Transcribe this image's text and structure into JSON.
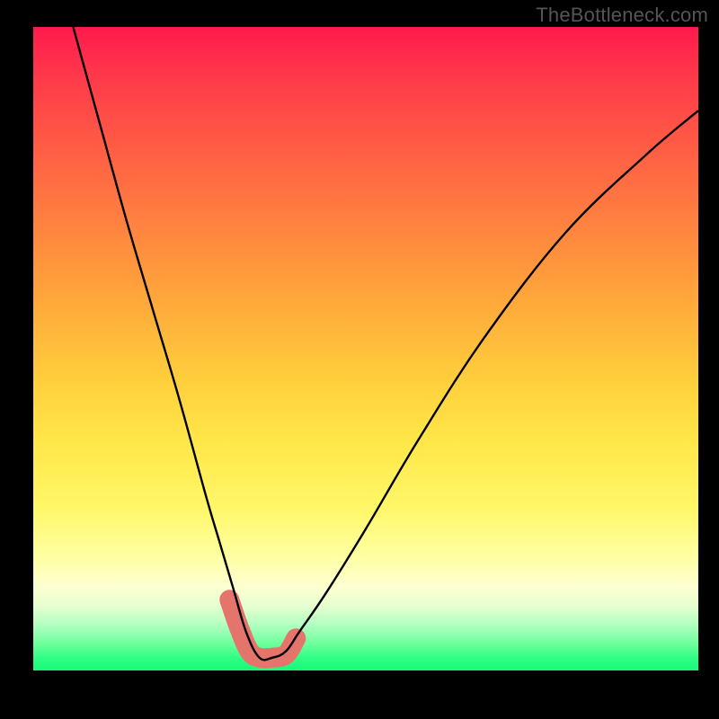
{
  "watermark": "TheBottleneck.com",
  "chart_data": {
    "type": "line",
    "title": "",
    "xlabel": "",
    "ylabel": "",
    "xlim": [
      0,
      100
    ],
    "ylim": [
      0,
      100
    ],
    "grid": false,
    "notes": "V-shaped bottleneck curve over vertical red→yellow→green gradient. Minimum of curve sits near x≈34, y≈0. Pink thick highlight segment around the trough.",
    "series": [
      {
        "name": "bottleneck-curve",
        "x": [
          6,
          10,
          14,
          18,
          22,
          26,
          28,
          30,
          32,
          34,
          36,
          38,
          40,
          44,
          50,
          58,
          68,
          80,
          92,
          100
        ],
        "y": [
          100,
          85,
          70,
          56,
          42,
          27,
          20,
          13,
          6,
          2,
          2,
          3,
          6,
          12,
          22,
          36,
          52,
          68,
          80,
          87
        ]
      }
    ],
    "highlight": {
      "name": "trough-highlight",
      "x": [
        29.5,
        31,
        32.5,
        34,
        36,
        38,
        39.5
      ],
      "y": [
        11,
        6.5,
        3,
        2,
        2,
        2.5,
        5
      ]
    },
    "gradient_stops": [
      {
        "pct": 0,
        "color": "#ff1a4d"
      },
      {
        "pct": 55,
        "color": "#ffcf3c"
      },
      {
        "pct": 87,
        "color": "#fdffd0"
      },
      {
        "pct": 100,
        "color": "#17f979"
      }
    ]
  }
}
